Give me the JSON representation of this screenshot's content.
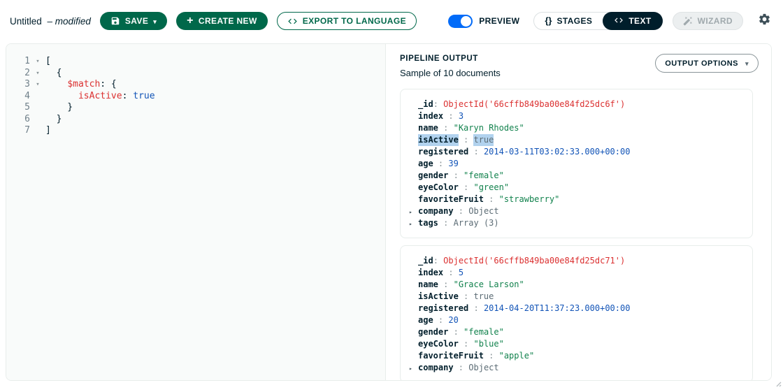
{
  "header": {
    "title": "Untitled",
    "modified": "– modified",
    "save_label": "SAVE",
    "create_new_label": "CREATE NEW",
    "export_label": "EXPORT TO LANGUAGE",
    "preview_label": "PREVIEW",
    "stages_label": "STAGES",
    "text_label": "TEXT",
    "wizard_label": "WIZARD"
  },
  "icons": {
    "caret_down": "▾",
    "expand_caret": "▸",
    "plus": "+",
    "braces": "{}"
  },
  "colors": {
    "brand_green": "#00684A",
    "dark_navy": "#001E2B",
    "toggle_blue": "#016BF8",
    "code_red": "#DB3030",
    "code_blue": "#1254B7",
    "string_green": "#12824D",
    "muted_gray": "#5C6C75",
    "highlight_blue": "#b1d2ee",
    "border_gray": "#E8EDEB"
  },
  "editor": {
    "lines": [
      {
        "num": "1",
        "fold": true,
        "tokens": [
          {
            "t": "[",
            "c": "plain"
          }
        ]
      },
      {
        "num": "2",
        "fold": true,
        "tokens": [
          {
            "t": "  {",
            "c": "plain"
          }
        ]
      },
      {
        "num": "3",
        "fold": true,
        "tokens": [
          {
            "t": "    ",
            "c": "plain"
          },
          {
            "t": "$match",
            "c": "key"
          },
          {
            "t": ": {",
            "c": "plain"
          }
        ]
      },
      {
        "num": "4",
        "fold": false,
        "tokens": [
          {
            "t": "      ",
            "c": "plain"
          },
          {
            "t": "isActive",
            "c": "key"
          },
          {
            "t": ": ",
            "c": "plain"
          },
          {
            "t": "true",
            "c": "bool"
          }
        ]
      },
      {
        "num": "5",
        "fold": false,
        "tokens": [
          {
            "t": "    }",
            "c": "plain"
          }
        ]
      },
      {
        "num": "6",
        "fold": false,
        "tokens": [
          {
            "t": "  }",
            "c": "plain"
          }
        ]
      },
      {
        "num": "7",
        "fold": false,
        "tokens": [
          {
            "t": "]",
            "c": "plain"
          }
        ]
      }
    ]
  },
  "output": {
    "title": "PIPELINE OUTPUT",
    "subtitle": "Sample of 10 documents",
    "options_label": "OUTPUT OPTIONS",
    "documents": [
      {
        "fields": [
          {
            "key": "_id",
            "sep": ": ",
            "value": "ObjectId('66cffb849ba00e84fd25dc6f')",
            "type": "objectid"
          },
          {
            "key": "index",
            "sep": " : ",
            "value": "3",
            "type": "number"
          },
          {
            "key": "name",
            "sep": " : ",
            "value": "\"Karyn Rhodes\"",
            "type": "string"
          },
          {
            "key": "isActive",
            "sep": " : ",
            "value": "true",
            "type": "boolean",
            "highlight": true
          },
          {
            "key": "registered",
            "sep": " : ",
            "value": "2014-03-11T03:02:33.000+00:00",
            "type": "date"
          },
          {
            "key": "age",
            "sep": " : ",
            "value": "39",
            "type": "number"
          },
          {
            "key": "gender",
            "sep": " : ",
            "value": "\"female\"",
            "type": "string"
          },
          {
            "key": "eyeColor",
            "sep": " : ",
            "value": "\"green\"",
            "type": "string"
          },
          {
            "key": "favoriteFruit",
            "sep": " : ",
            "value": "\"strawberry\"",
            "type": "string"
          },
          {
            "key": "company",
            "sep": " : ",
            "value": "Object",
            "type": "object",
            "expandable": true
          },
          {
            "key": "tags",
            "sep": " : ",
            "value": "Array (3)",
            "type": "array",
            "expandable": true
          }
        ]
      },
      {
        "fields": [
          {
            "key": "_id",
            "sep": ": ",
            "value": "ObjectId('66cffb849ba00e84fd25dc71')",
            "type": "objectid"
          },
          {
            "key": "index",
            "sep": " : ",
            "value": "5",
            "type": "number"
          },
          {
            "key": "name",
            "sep": " : ",
            "value": "\"Grace Larson\"",
            "type": "string"
          },
          {
            "key": "isActive",
            "sep": " : ",
            "value": "true",
            "type": "boolean"
          },
          {
            "key": "registered",
            "sep": " : ",
            "value": "2014-04-20T11:37:23.000+00:00",
            "type": "date"
          },
          {
            "key": "age",
            "sep": " : ",
            "value": "20",
            "type": "number"
          },
          {
            "key": "gender",
            "sep": " : ",
            "value": "\"female\"",
            "type": "string"
          },
          {
            "key": "eyeColor",
            "sep": " : ",
            "value": "\"blue\"",
            "type": "string"
          },
          {
            "key": "favoriteFruit",
            "sep": " : ",
            "value": "\"apple\"",
            "type": "string"
          },
          {
            "key": "company",
            "sep": " : ",
            "value": "Object",
            "type": "object",
            "expandable": true
          }
        ]
      }
    ]
  }
}
